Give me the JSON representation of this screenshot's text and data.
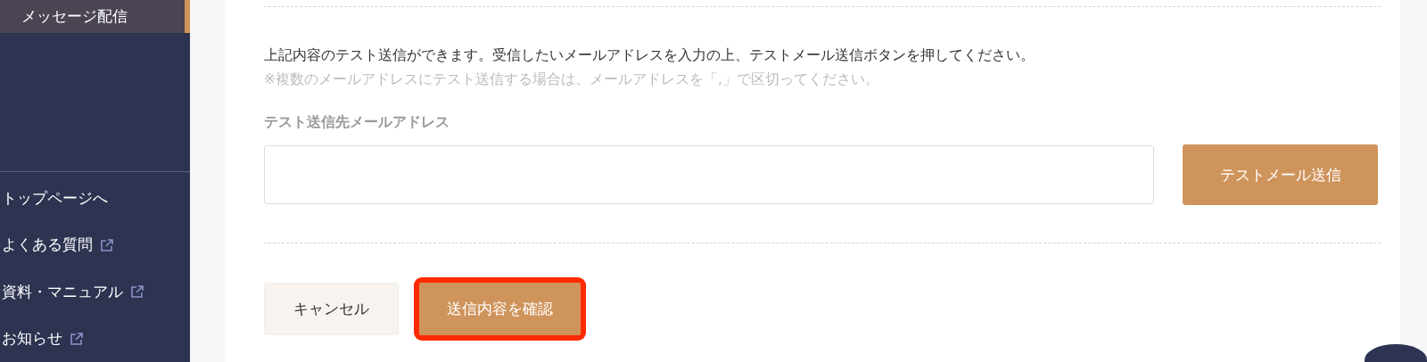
{
  "sidebar": {
    "items": [
      {
        "label": "メッセージ配信",
        "selected": true,
        "external": false
      },
      {
        "label": "トップページへ",
        "selected": false,
        "external": false
      },
      {
        "label": "よくある質問",
        "selected": false,
        "external": true
      },
      {
        "label": "資料・マニュアル",
        "selected": false,
        "external": true
      },
      {
        "label": "お知らせ",
        "selected": false,
        "external": true
      }
    ]
  },
  "test_send": {
    "description": "上記内容のテスト送信ができます。受信したいメールアドレスを入力の上、テストメール送信ボタンを押してください。",
    "note": "※複数のメールアドレスにテスト送信する場合は、メールアドレスを「,」で区切ってください。",
    "field_label": "テスト送信先メールアドレス",
    "send_button": "テストメール送信"
  },
  "actions": [
    {
      "label": "キャンセル",
      "kind": "secondary",
      "highlighted": false
    },
    {
      "label": "送信内容を確認",
      "kind": "primary",
      "highlighted": true
    }
  ]
}
